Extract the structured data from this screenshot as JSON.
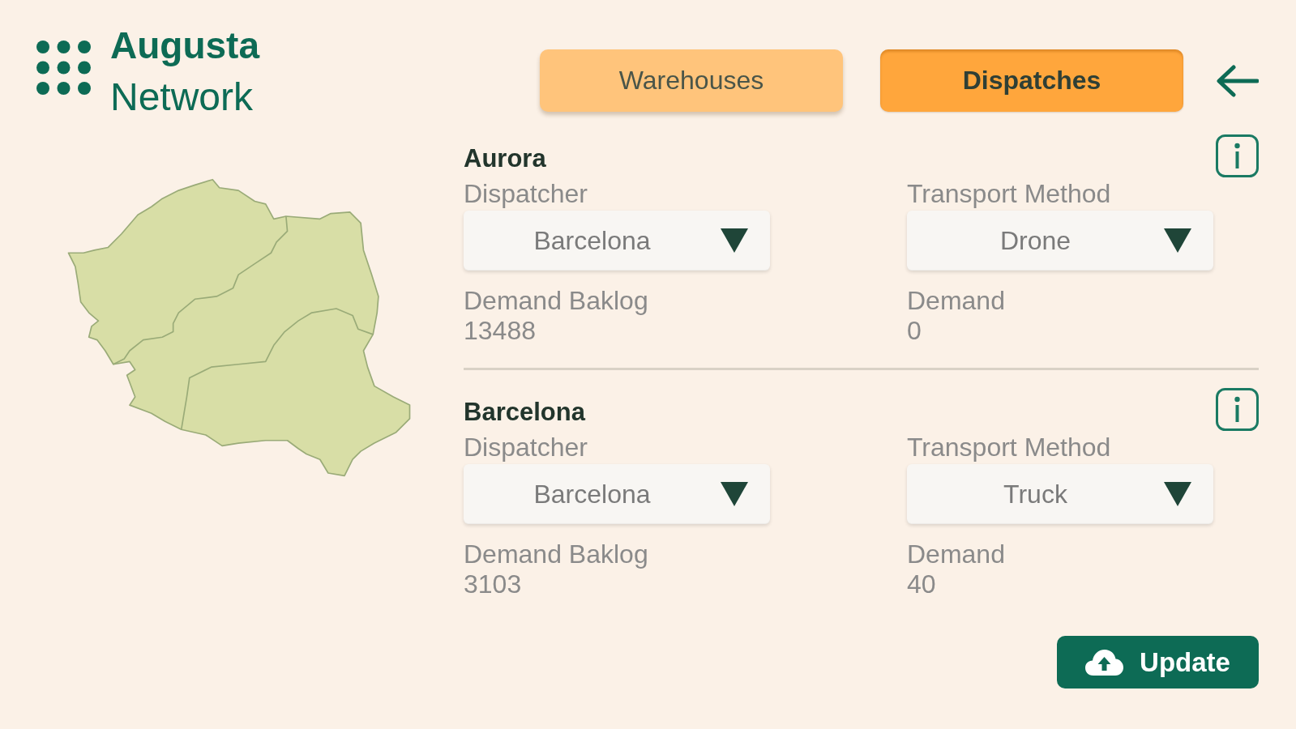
{
  "logo": {
    "title": "Augusta",
    "subtitle": "Network"
  },
  "tabs": [
    {
      "label": "Warehouses",
      "selected": false
    },
    {
      "label": "Dispatches",
      "selected": true
    }
  ],
  "regions": [
    {
      "name": "Aurora",
      "dispatcher": {
        "label": "Dispatcher",
        "value": "Barcelona"
      },
      "transport_method": {
        "label": "Transport Method",
        "value": "Drone"
      },
      "demand_backlog": {
        "label": "Demand Baklog",
        "value": "13488"
      },
      "demand": {
        "label": "Demand",
        "value": "0"
      }
    },
    {
      "name": "Barcelona",
      "dispatcher": {
        "label": "Dispatcher",
        "value": "Barcelona"
      },
      "transport_method": {
        "label": "Transport Method",
        "value": "Truck"
      },
      "demand_backlog": {
        "label": "Demand Baklog",
        "value": "3103"
      },
      "demand": {
        "label": "Demand",
        "value": "40"
      }
    }
  ],
  "update_button": {
    "label": "Update"
  }
}
